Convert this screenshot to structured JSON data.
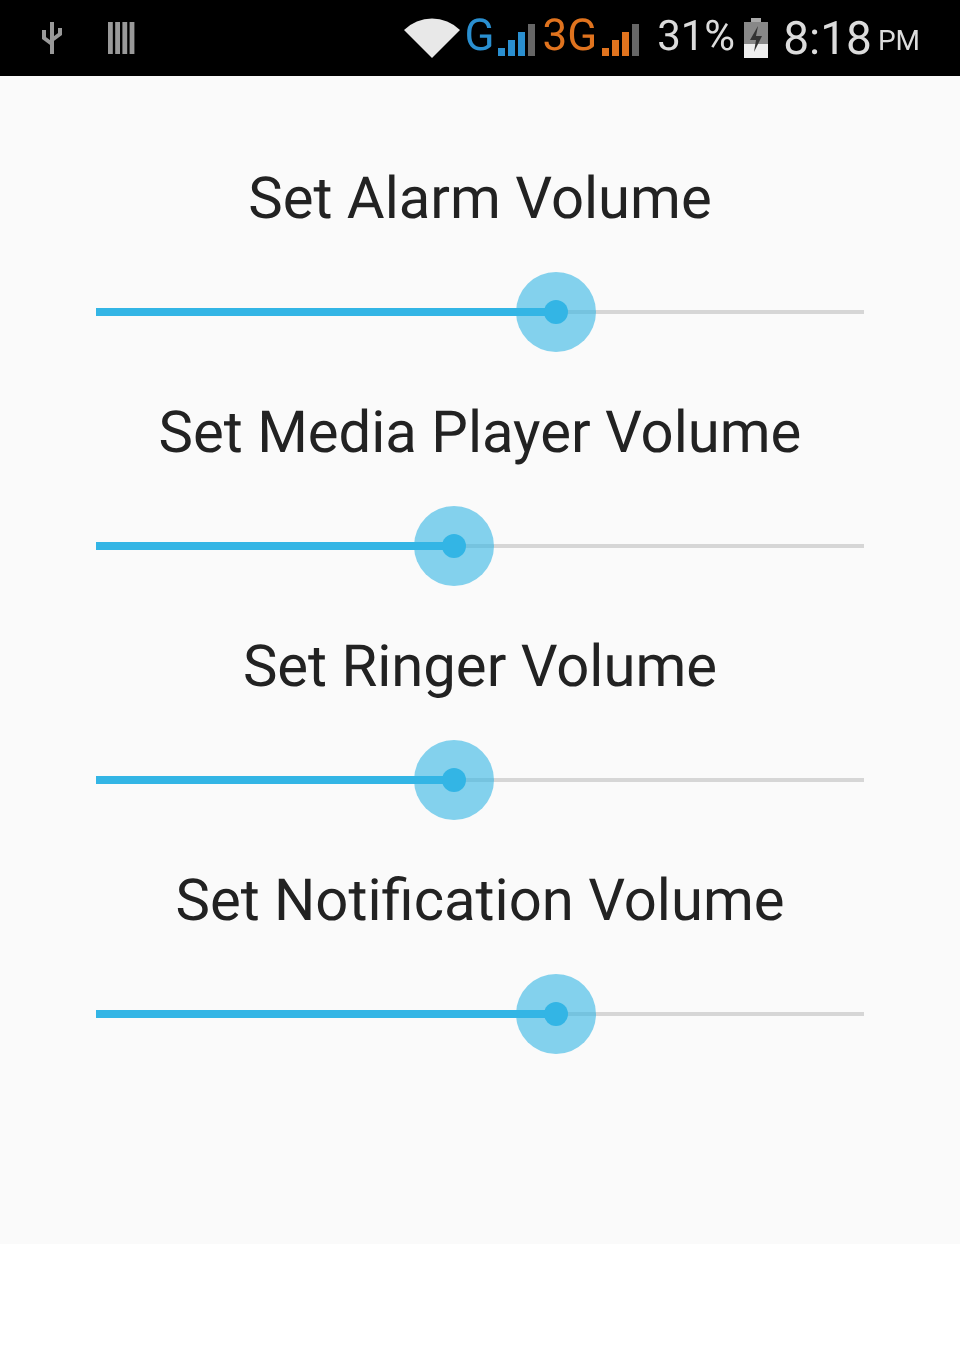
{
  "status_bar": {
    "networks": [
      {
        "label": "G",
        "color": "#2a8fd0"
      },
      {
        "label": "3G",
        "color": "#e0731e"
      }
    ],
    "battery": "31%",
    "time": "8:18",
    "period": "PM"
  },
  "volumes": [
    {
      "title": "Set Alarm Volume",
      "level": 0.6
    },
    {
      "title": "Set Media Player Volume",
      "level": 0.466
    },
    {
      "title": "Set Ringer Volume",
      "level": 0.466
    },
    {
      "title": "Set Notification Volume",
      "level": 0.6
    }
  ]
}
